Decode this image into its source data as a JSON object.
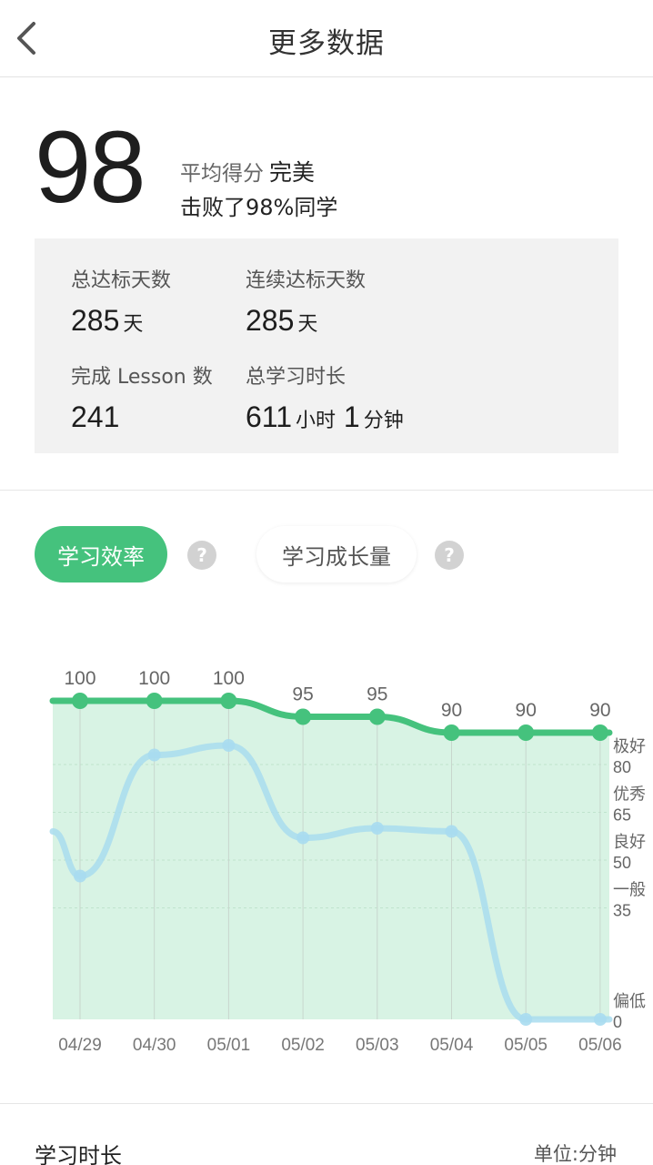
{
  "header": {
    "title": "更多数据",
    "back_icon": "chevron-left-icon"
  },
  "score": {
    "value": "98",
    "avg_label": "平均得分",
    "level": "完美",
    "beat_text": "击败了98%同学"
  },
  "stats": {
    "total_days_label": "总达标天数",
    "total_days_value": "285",
    "total_days_unit": "天",
    "consecutive_label": "连续达标天数",
    "consecutive_value": "285",
    "consecutive_unit": "天",
    "lessons_label": "完成 Lesson 数",
    "lessons_value": "241",
    "time_label": "总学习时长",
    "time_hours": "611",
    "time_hours_unit": "小时",
    "time_minutes": "1",
    "time_minutes_unit": "分钟"
  },
  "tabs": {
    "efficiency": "学习效率",
    "growth": "学习成长量",
    "help_glyph": "?"
  },
  "colors": {
    "accent": "#45c27d",
    "area_fill": "#d8f3e4",
    "secondary_line": "#a9dcef"
  },
  "chart_data": {
    "type": "line",
    "categories": [
      "04/29",
      "04/30",
      "05/01",
      "05/02",
      "05/03",
      "05/04",
      "05/05",
      "05/06"
    ],
    "series": [
      {
        "values": [
          100,
          100,
          100,
          95,
          95,
          90,
          90,
          90
        ]
      },
      {
        "values": [
          45,
          83,
          86,
          57,
          60,
          59,
          0,
          0
        ]
      }
    ],
    "y_ticks": [
      {
        "name": "极好",
        "value": 80
      },
      {
        "name": "优秀",
        "value": 65
      },
      {
        "name": "良好",
        "value": 50
      },
      {
        "name": "一般",
        "value": 35
      },
      {
        "name": "偏低",
        "value": 0
      }
    ],
    "ylim": [
      0,
      100
    ],
    "grid": true
  },
  "bottom": {
    "title": "学习时长",
    "unit": "单位:分钟"
  }
}
